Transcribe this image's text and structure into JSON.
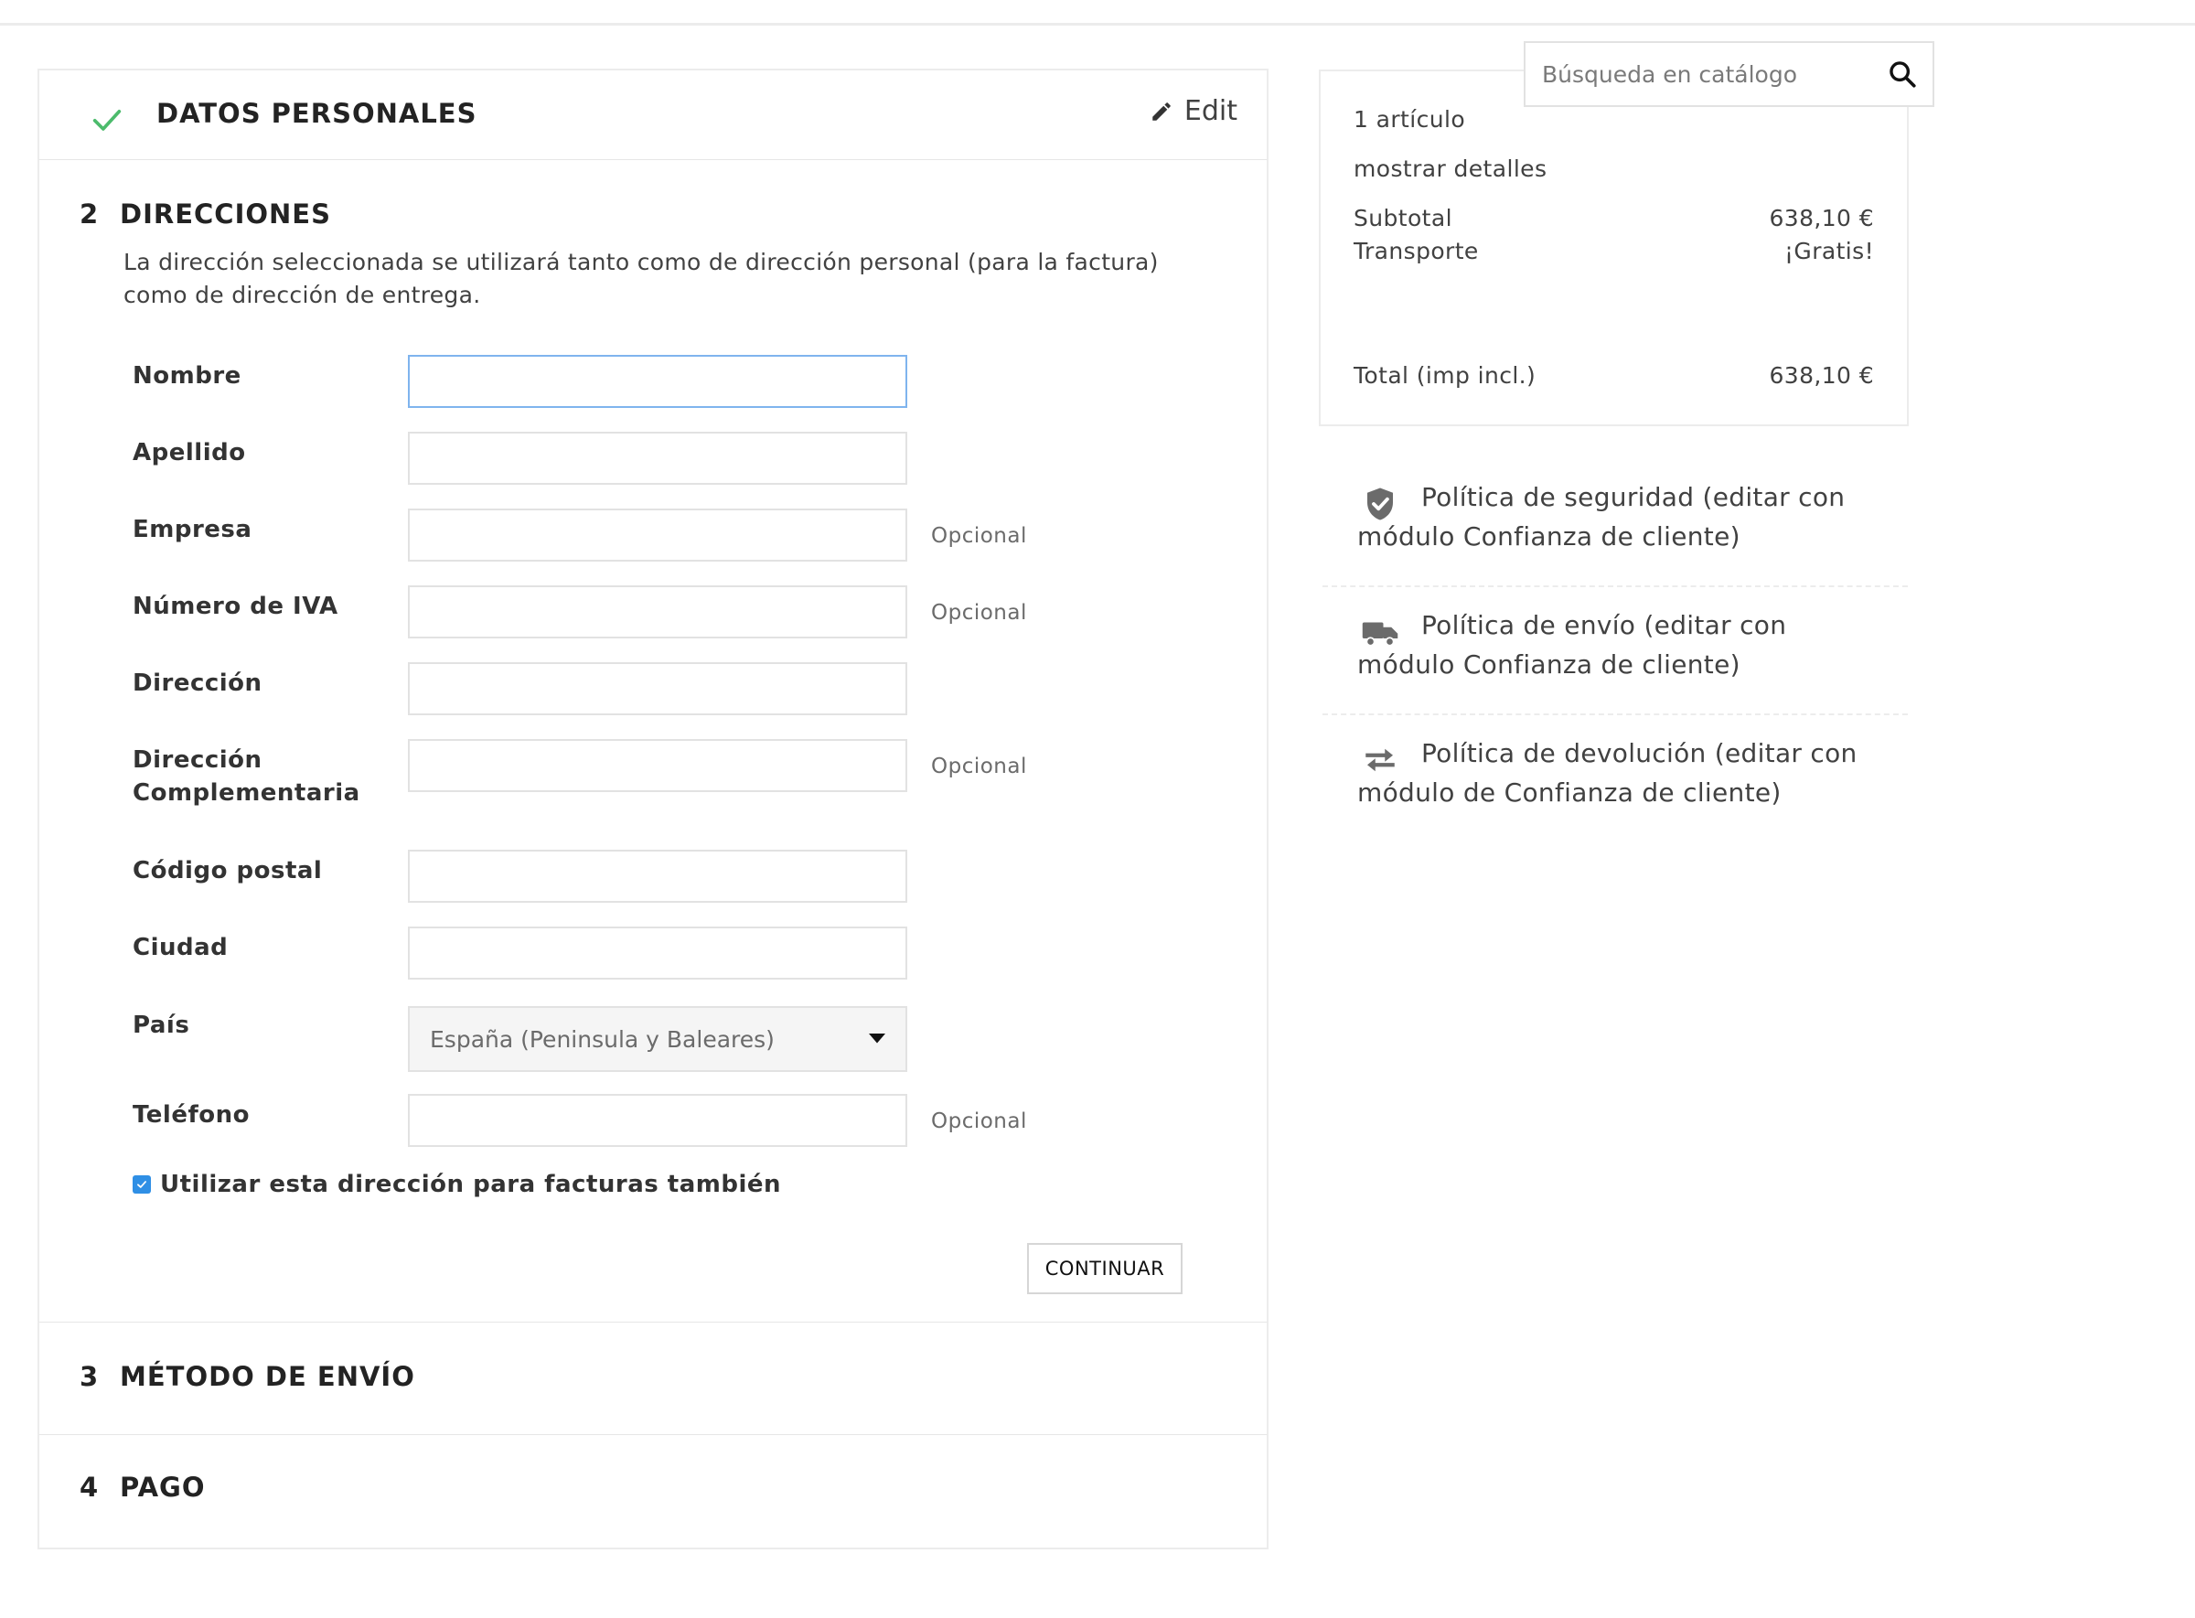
{
  "personal": {
    "title": "DATOS PERSONALES",
    "edit_label": "Edit"
  },
  "address": {
    "step": "2",
    "title": "DIRECCIONES",
    "description": "La dirección seleccionada se utilizará tanto como de dirección personal (para la factura) como de dirección de entrega.",
    "optional_label": "Opcional",
    "fields": {
      "nombre": {
        "label": "Nombre",
        "value": ""
      },
      "apellido": {
        "label": "Apellido",
        "value": ""
      },
      "empresa": {
        "label": "Empresa",
        "value": ""
      },
      "iva": {
        "label": "Número de IVA",
        "value": ""
      },
      "direccion": {
        "label": "Dirección",
        "value": ""
      },
      "direccion2": {
        "label": "Dirección Complementaria",
        "value": ""
      },
      "postal": {
        "label": "Código postal",
        "value": ""
      },
      "ciudad": {
        "label": "Ciudad",
        "value": ""
      },
      "pais": {
        "label": "País",
        "selected": "España (Peninsula y Baleares)"
      },
      "telefono": {
        "label": "Teléfono",
        "value": ""
      }
    },
    "use_for_invoice": {
      "label": "Utilizar esta dirección para facturas también",
      "checked": true
    },
    "continue_label": "CONTINUAR"
  },
  "shipping": {
    "step": "3",
    "title": "MÉTODO DE ENVÍO"
  },
  "payment": {
    "step": "4",
    "title": "PAGO"
  },
  "search": {
    "placeholder": "Búsqueda en catálogo"
  },
  "cart": {
    "items_count": "1 artículo",
    "show_details": "mostrar detalles",
    "subtotal_label": "Subtotal",
    "subtotal_value": "638,10 €",
    "shipping_label": "Transporte",
    "shipping_value": "¡Gratis!",
    "total_label": "Total (imp incl.)",
    "total_value": "638,10 €"
  },
  "reassurance": [
    {
      "icon": "shield-check-icon",
      "text": "Política de seguridad (editar con módulo Confianza de cliente)"
    },
    {
      "icon": "truck-icon",
      "text": "Política de envío (editar con módulo Confianza de cliente)"
    },
    {
      "icon": "exchange-arrows-icon",
      "text": "Política de devolución (editar con módulo de Confianza de cliente)"
    }
  ],
  "colors": {
    "accent_check": "#4cbb6c",
    "focus_border": "#7fb4ee",
    "checkbox": "#2f8fe5",
    "text_dark": "#232323",
    "text_muted": "#414141"
  }
}
